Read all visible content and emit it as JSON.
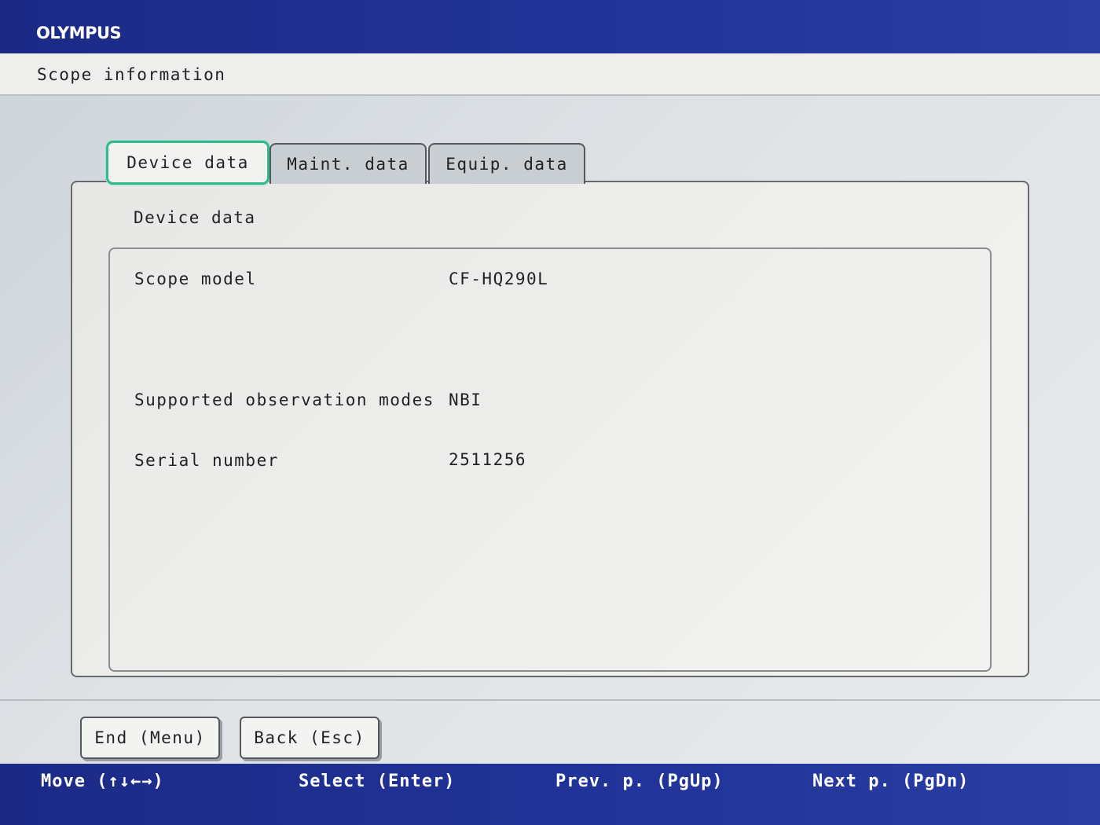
{
  "brand": {
    "logo": "OLYMPUS"
  },
  "header": {
    "title": "Scope information"
  },
  "tabs": [
    {
      "label": "Device data",
      "active": true
    },
    {
      "label": "Maint. data",
      "active": false
    },
    {
      "label": "Equip. data",
      "active": false
    }
  ],
  "panel": {
    "heading": "Device data",
    "rows": [
      {
        "label": "Scope model",
        "value": "CF-HQ290L"
      },
      {
        "label": "Supported observation modes",
        "value": "NBI"
      },
      {
        "label": "Serial number",
        "value": "2511256"
      }
    ]
  },
  "buttons": {
    "end": "End (Menu)",
    "back": "Back (Esc)"
  },
  "key_hints": {
    "move": "Move (↑↓←→)",
    "select": "Select (Enter)",
    "prev": "Prev. p. (PgUp)",
    "next": "Next p. (PgDn)"
  },
  "colors": {
    "brand_blue": "#22349a",
    "active_tab_border": "#34b98e"
  }
}
